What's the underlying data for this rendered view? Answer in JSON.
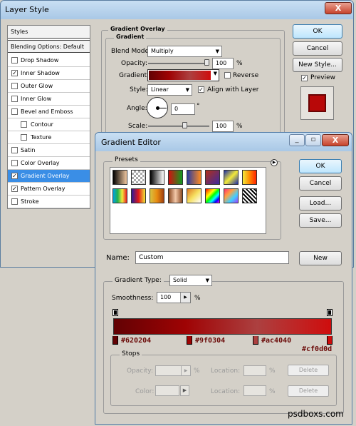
{
  "ls": {
    "title": "Layer Style",
    "close": "X",
    "styles_header": "Styles",
    "blending": "Blending Options: Default",
    "items": [
      {
        "label": "Drop Shadow",
        "checked": ""
      },
      {
        "label": "Inner Shadow",
        "checked": "✓"
      },
      {
        "label": "Outer Glow",
        "checked": ""
      },
      {
        "label": "Inner Glow",
        "checked": ""
      },
      {
        "label": "Bevel and Emboss",
        "checked": ""
      },
      {
        "label": "Contour",
        "checked": ""
      },
      {
        "label": "Texture",
        "checked": ""
      },
      {
        "label": "Satin",
        "checked": ""
      },
      {
        "label": "Color Overlay",
        "checked": ""
      },
      {
        "label": "Gradient Overlay",
        "checked": "✓"
      },
      {
        "label": "Pattern Overlay",
        "checked": "✓"
      },
      {
        "label": "Stroke",
        "checked": ""
      }
    ],
    "group_title": "Gradient Overlay",
    "sub_title": "Gradient",
    "blend_label": "Blend Mode:",
    "blend_value": "Multiply",
    "opacity_label": "Opacity:",
    "opacity_value": "100",
    "pct": "%",
    "gradient_label": "Gradient:",
    "reverse": "Reverse",
    "style_label": "Style:",
    "style_value": "Linear",
    "align": "Align with Layer",
    "angle_label": "Angle:",
    "angle_value": "0",
    "deg": "°",
    "scale_label": "Scale:",
    "scale_value": "100",
    "ok": "OK",
    "cancel": "Cancel",
    "new_style": "New Style...",
    "preview": "Preview",
    "check": "✓"
  },
  "ge": {
    "title": "Gradient Editor",
    "presets": "Presets",
    "ok": "OK",
    "cancel": "Cancel",
    "load": "Load...",
    "save": "Save...",
    "name_label": "Name:",
    "name_value": "Custom",
    "new": "New",
    "type_label": "Gradient Type:",
    "type_value": "Solid",
    "smooth_label": "Smoothness:",
    "smooth_value": "100",
    "pct": "%",
    "stops": [
      {
        "hex": "#620204",
        "pos": 0
      },
      {
        "hex": "#9f0304",
        "pos": 0.33
      },
      {
        "hex": "#ac4040",
        "pos": 0.66
      },
      {
        "hex": "#cf0d0d",
        "pos": 1
      }
    ],
    "stops_title": "Stops",
    "opacity_label": "Opacity:",
    "location_label": "Location:",
    "color_label": "Color:",
    "delete": "Delete"
  },
  "colors": {
    "accent": "#3a8ee6",
    "gradient_start": "#620204",
    "gradient_end": "#cf0d0d"
  },
  "watermark": "psdboxs.com"
}
